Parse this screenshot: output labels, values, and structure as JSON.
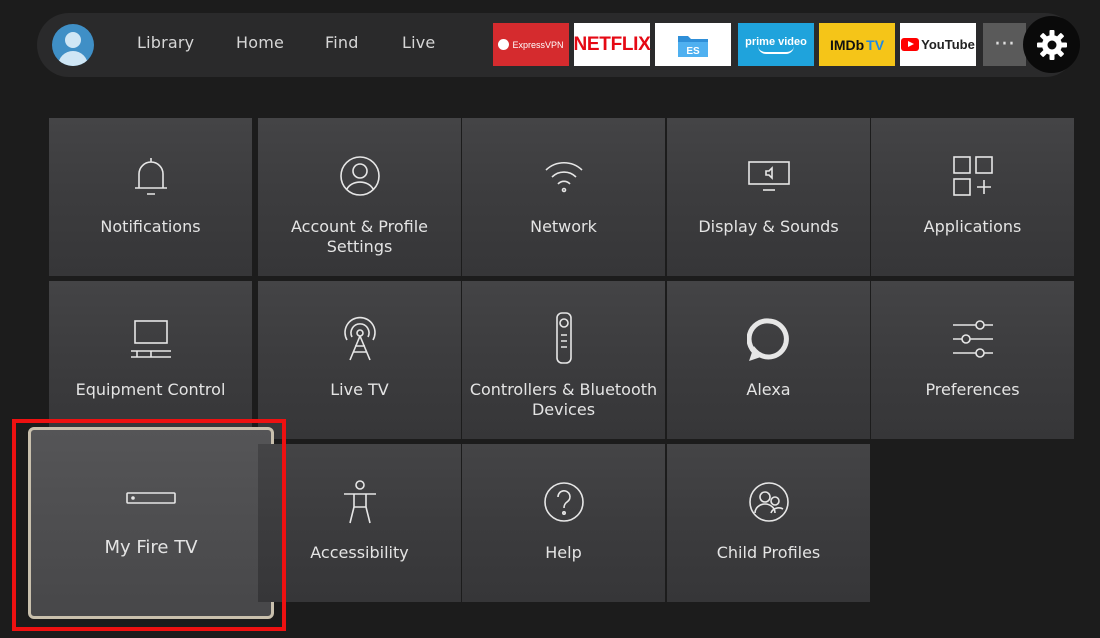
{
  "nav": {
    "items": [
      "Library",
      "Home",
      "Find",
      "Live"
    ]
  },
  "apps": {
    "expressvpn": "ExpressVPN",
    "netflix": "NETFLIX",
    "prime_line1": "prime video",
    "imdb": "IMDb",
    "imdb_tv": "TV",
    "youtube": "YouTube",
    "more": "···"
  },
  "tiles": [
    {
      "label": "Notifications",
      "icon": "bell-icon"
    },
    {
      "label": "Account & Profile Settings",
      "icon": "profile-icon"
    },
    {
      "label": "Network",
      "icon": "wifi-icon"
    },
    {
      "label": "Display & Sounds",
      "icon": "display-icon"
    },
    {
      "label": "Applications",
      "icon": "apps-grid-icon"
    },
    {
      "label": "Equipment Control",
      "icon": "equipment-icon"
    },
    {
      "label": "Live TV",
      "icon": "antenna-icon"
    },
    {
      "label": "Controllers & Bluetooth Devices",
      "icon": "remote-icon"
    },
    {
      "label": "Alexa",
      "icon": "alexa-ring-icon"
    },
    {
      "label": "Preferences",
      "icon": "sliders-icon"
    },
    {
      "label": "My Fire TV",
      "icon": "fire-tv-stick-icon",
      "focused": true
    },
    {
      "label": "Accessibility",
      "icon": "accessibility-icon"
    },
    {
      "label": "Help",
      "icon": "help-icon"
    },
    {
      "label": "Child Profiles",
      "icon": "child-profiles-icon"
    }
  ],
  "colors": {
    "background": "#1c1c1c",
    "tile": "#3e3e40",
    "highlight": "#e11111",
    "focus_border": "#c9c0ad"
  }
}
